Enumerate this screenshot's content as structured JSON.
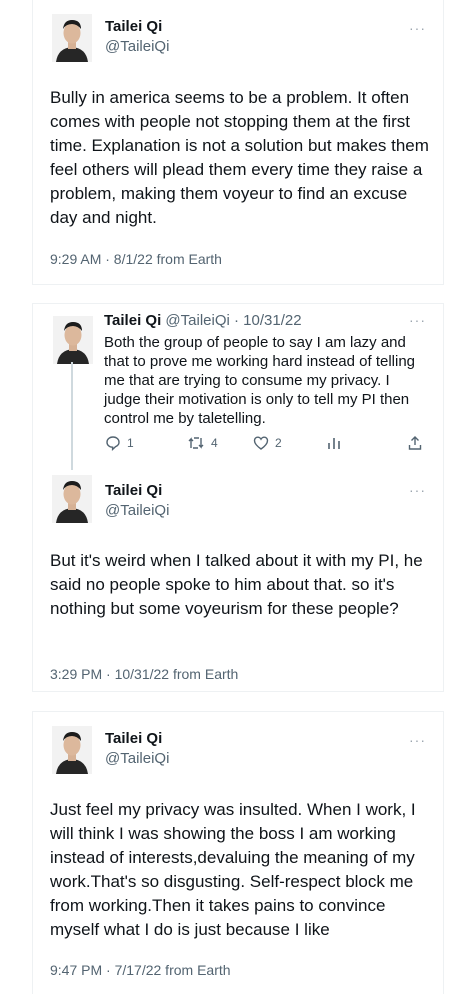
{
  "tweet1": {
    "name": "Tailei Qi",
    "handle": "@TaileiQi",
    "more": "···",
    "body": "Bully in america seems to be a problem. It often comes with people not stopping them at the first time. Explanation is not a solution but makes them feel others will plead them every time they raise a problem, making them voyeur to find an excuse day and night.",
    "meta": "9:29 AM · 8/1/22 from Earth"
  },
  "reply": {
    "name": "Tailei Qi",
    "handle": "@TaileiQi",
    "date": "· 10/31/22",
    "more": "···",
    "body": "Both the group of people to say I am lazy and that to prove me working hard instead of telling me that are trying to consume my privacy. I judge their motivation is only to tell my PI then control me by taletelling.",
    "replies": "1",
    "retweets": "4",
    "likes": "2"
  },
  "tweet2": {
    "name": "Tailei Qi",
    "handle": "@TaileiQi",
    "more": "···",
    "body": "But it's weird when I talked about it with my PI, he said no people spoke to him about that. so it's nothing but some voyeurism for these people?",
    "meta": "3:29 PM · 10/31/22 from Earth"
  },
  "tweet3": {
    "name": "Tailei Qi",
    "handle": "@TaileiQi",
    "more": "···",
    "body": "Just feel my privacy was insulted.  When I work, I will think I was showing the boss I am working instead of interests,devaluing the meaning of my work.That's so disgusting. Self-respect block me from working.Then it takes pains to convince myself what I do is just because I like",
    "meta": "9:47 PM · 7/17/22 from Earth"
  },
  "colors": {
    "text": "#0f1419",
    "secondary": "#536471",
    "border": "#eef1f3"
  }
}
